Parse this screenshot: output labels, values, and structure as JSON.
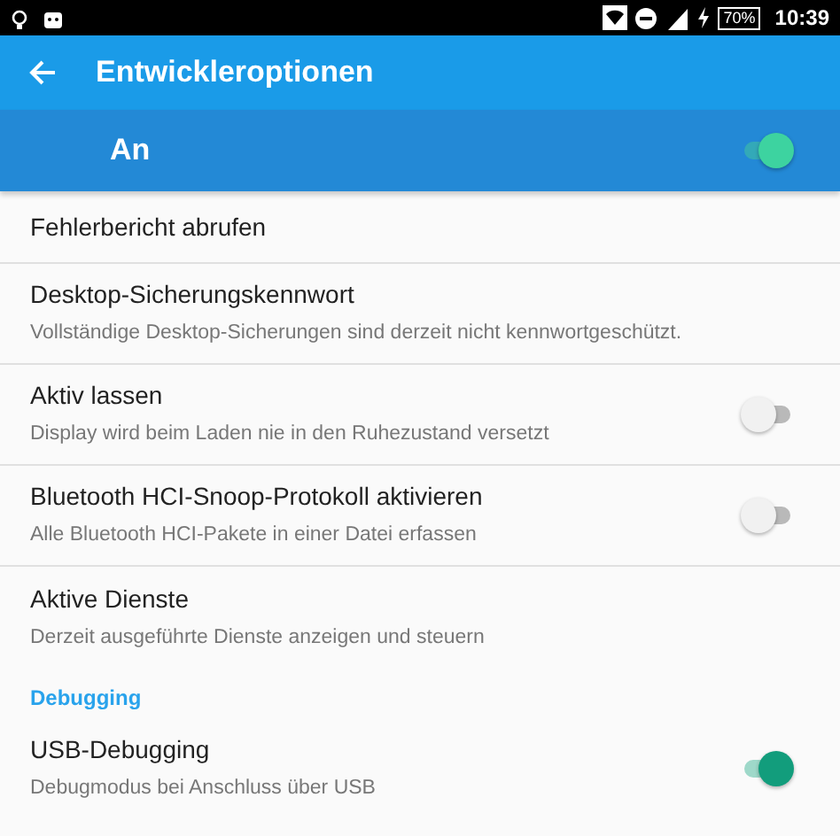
{
  "status_bar": {
    "battery": "70%",
    "time": "10:39"
  },
  "app_bar": {
    "title": "Entwickleroptionen"
  },
  "master": {
    "label": "An",
    "on": true
  },
  "items": [
    {
      "kind": "action",
      "title": "Fehlerbericht abrufen"
    },
    {
      "kind": "action",
      "title": "Desktop-Sicherungskennwort",
      "summary": "Vollständige Desktop-Sicherungen sind derzeit nicht kennwortgeschützt."
    },
    {
      "kind": "switch",
      "title": "Aktiv lassen",
      "summary": "Display wird beim Laden nie in den Ruhezustand versetzt",
      "on": false
    },
    {
      "kind": "switch",
      "title": "Bluetooth HCI-Snoop-Protokoll aktivieren",
      "summary": "Alle Bluetooth HCI-Pakete in einer Datei erfassen",
      "on": false
    },
    {
      "kind": "action",
      "title": "Aktive Dienste",
      "summary": "Derzeit ausgeführte Dienste anzeigen und steuern"
    },
    {
      "kind": "header",
      "title": "Debugging"
    },
    {
      "kind": "switch",
      "title": "USB-Debugging",
      "summary": "Debugmodus bei Anschluss über USB",
      "on": true
    }
  ]
}
